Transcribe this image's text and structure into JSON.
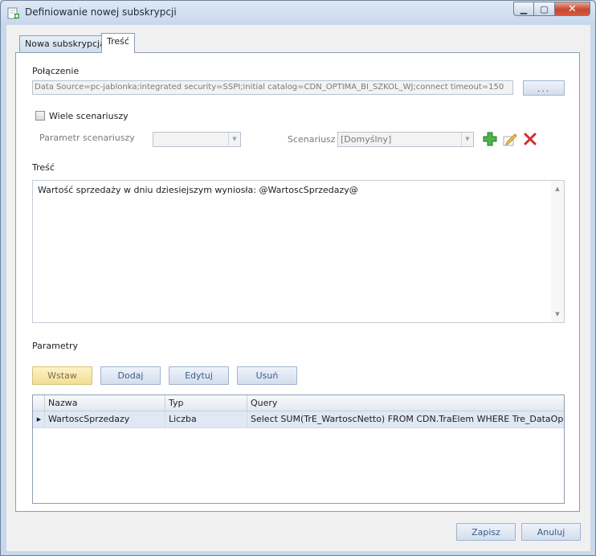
{
  "window": {
    "title": "Definiowanie nowej subskrypcji",
    "minimize_glyph": "▁",
    "maximize_glyph": "▢",
    "close_glyph": "✕"
  },
  "tabs": [
    {
      "label": "Nowa subskrypcja",
      "active": false
    },
    {
      "label": "Treść",
      "active": true
    }
  ],
  "connection": {
    "label": "Połączenie",
    "value": "Data Source=pc-jablonka;integrated security=SSPI;initial catalog=CDN_OPTIMA_BI_SZKOL_WJ;connect timeout=150",
    "browse_label": "..."
  },
  "scenarios": {
    "multi_label": "Wiele scenariuszy",
    "multi_checked": false,
    "param_label": "Parametr scenariuszy",
    "param_value": "",
    "scenario_label": "Scenariusz",
    "scenario_value": "[Domyślny]"
  },
  "content": {
    "label": "Treść",
    "text": "Wartość sprzedaży w dniu dziesiejszym wyniosła: @WartoscSprzedazy@"
  },
  "parameters": {
    "label": "Parametry",
    "buttons": {
      "insert": "Wstaw",
      "add": "Dodaj",
      "edit": "Edytuj",
      "remove": "Usuń"
    },
    "columns": [
      "Nazwa",
      "Typ",
      "Query"
    ],
    "rows": [
      {
        "name": "WartoscSprzedazy",
        "type": "Liczba",
        "query": "Select SUM(TrE_WartoscNetto) FROM CDN.TraElem WHERE Tre_DataOpe = '..."
      }
    ]
  },
  "footer": {
    "save": "Zapisz",
    "cancel": "Anuluj"
  },
  "colors": {
    "accent": "#3a5c8e",
    "selected_row": "#dfe8f4",
    "insert_button": "#f1dd92"
  }
}
